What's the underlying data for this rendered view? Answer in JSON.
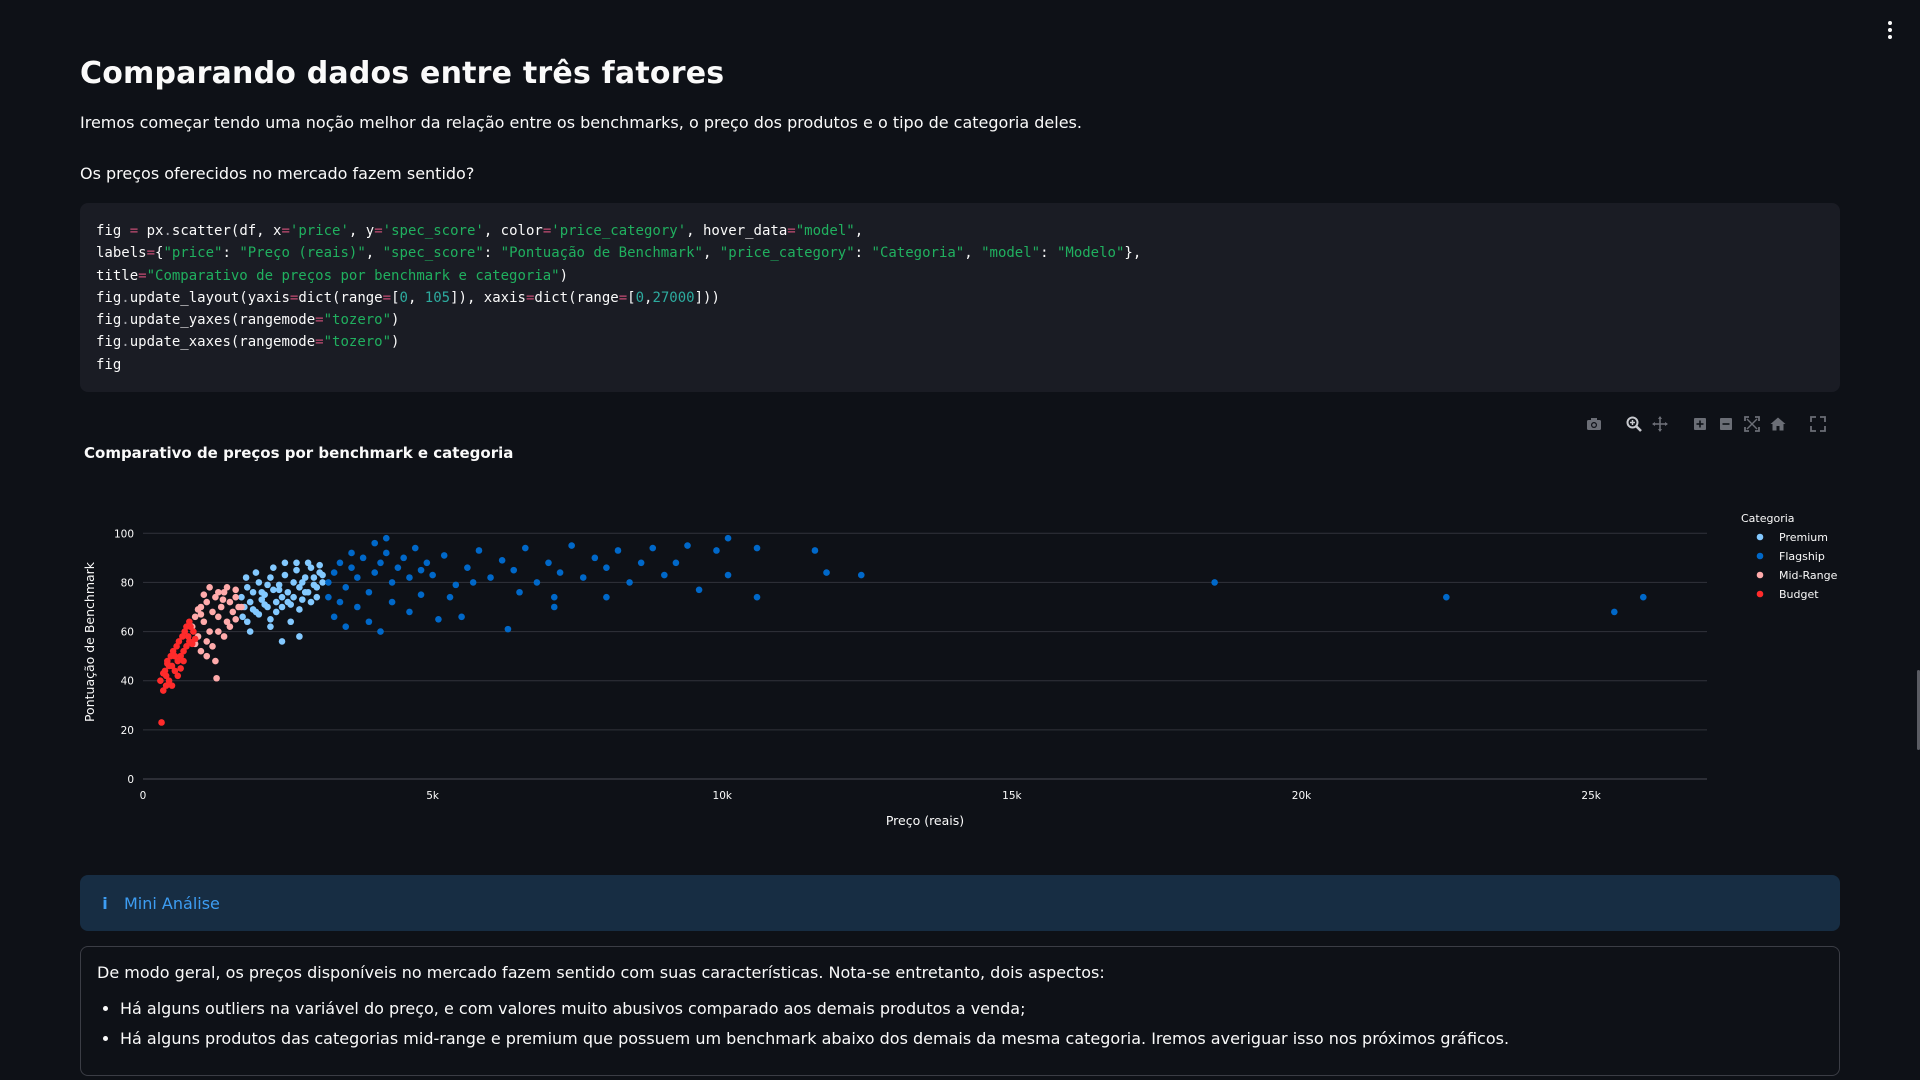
{
  "page": {
    "title": "Comparando dados entre três fatores",
    "intro": "Iremos começar tendo uma noção melhor da relação entre os benchmarks, o preço dos produtos e o tipo de categoria deles.",
    "question": "Os preços oferecidos no mercado fazem sentido?"
  },
  "code": {
    "lines": [
      [
        {
          "t": "fig "
        },
        {
          "t": "=",
          "c": "op"
        },
        {
          "t": " px"
        },
        {
          "t": ".",
          "c": "dim"
        },
        {
          "t": "scatter(df, x"
        },
        {
          "t": "=",
          "c": "op"
        },
        {
          "t": "'price'",
          "c": "str"
        },
        {
          "t": ", y"
        },
        {
          "t": "=",
          "c": "op"
        },
        {
          "t": "'spec_score'",
          "c": "str"
        },
        {
          "t": ", color"
        },
        {
          "t": "=",
          "c": "op"
        },
        {
          "t": "'price_category'",
          "c": "str"
        },
        {
          "t": ", hover_data"
        },
        {
          "t": "=",
          "c": "op"
        },
        {
          "t": "\"model\"",
          "c": "str"
        },
        {
          "t": ","
        }
      ],
      [
        {
          "t": "labels"
        },
        {
          "t": "=",
          "c": "op"
        },
        {
          "t": "{"
        },
        {
          "t": "\"price\"",
          "c": "str"
        },
        {
          "t": ": "
        },
        {
          "t": "\"Preço (reais)\"",
          "c": "str"
        },
        {
          "t": ", "
        },
        {
          "t": "\"spec_score\"",
          "c": "str"
        },
        {
          "t": ": "
        },
        {
          "t": "\"Pontuação de Benchmark\"",
          "c": "str"
        },
        {
          "t": ", "
        },
        {
          "t": "\"price_category\"",
          "c": "str"
        },
        {
          "t": ": "
        },
        {
          "t": "\"Categoria\"",
          "c": "str"
        },
        {
          "t": ", "
        },
        {
          "t": "\"model\"",
          "c": "str"
        },
        {
          "t": ": "
        },
        {
          "t": "\"Modelo\"",
          "c": "str"
        },
        {
          "t": "},"
        }
      ],
      [
        {
          "t": "title"
        },
        {
          "t": "=",
          "c": "op"
        },
        {
          "t": "\"Comparativo de preços por benchmark e categoria\"",
          "c": "str"
        },
        {
          "t": ")"
        }
      ],
      [
        {
          "t": "fig"
        },
        {
          "t": ".",
          "c": "dim"
        },
        {
          "t": "update_layout(yaxis"
        },
        {
          "t": "=",
          "c": "op"
        },
        {
          "t": "dict(range"
        },
        {
          "t": "=",
          "c": "op"
        },
        {
          "t": "["
        },
        {
          "t": "0",
          "c": "num"
        },
        {
          "t": ", "
        },
        {
          "t": "105",
          "c": "num"
        },
        {
          "t": "]), xaxis"
        },
        {
          "t": "=",
          "c": "op"
        },
        {
          "t": "dict(range"
        },
        {
          "t": "=",
          "c": "op"
        },
        {
          "t": "["
        },
        {
          "t": "0",
          "c": "num"
        },
        {
          "t": ","
        },
        {
          "t": "27000",
          "c": "num"
        },
        {
          "t": "]))"
        }
      ],
      [
        {
          "t": "fig"
        },
        {
          "t": ".",
          "c": "dim"
        },
        {
          "t": "update_yaxes(rangemode"
        },
        {
          "t": "=",
          "c": "op"
        },
        {
          "t": "\"tozero\"",
          "c": "str"
        },
        {
          "t": ")"
        }
      ],
      [
        {
          "t": "fig"
        },
        {
          "t": ".",
          "c": "dim"
        },
        {
          "t": "update_xaxes(rangemode"
        },
        {
          "t": "=",
          "c": "op"
        },
        {
          "t": "\"tozero\"",
          "c": "str"
        },
        {
          "t": ")"
        }
      ],
      [
        {
          "t": "fig"
        }
      ]
    ]
  },
  "chart_data": {
    "type": "scatter",
    "title": "Comparativo de preços por benchmark e categoria",
    "xlabel": "Preço (reais)",
    "ylabel": "Pontuação de Benchmark",
    "xlim": [
      0,
      27000
    ],
    "ylim": [
      0,
      105
    ],
    "xticks": [
      0,
      5000,
      10000,
      15000,
      20000,
      25000
    ],
    "xtick_labels": [
      "0",
      "5k",
      "10k",
      "15k",
      "20k",
      "25k"
    ],
    "yticks": [
      0,
      20,
      40,
      60,
      80,
      100
    ],
    "grid": true,
    "legend_title": "Categoria",
    "legend_position": "right",
    "series": [
      {
        "name": "Premium",
        "color": "#83c9ff",
        "points": [
          [
            1700,
            74
          ],
          [
            1750,
            70
          ],
          [
            1800,
            78
          ],
          [
            1850,
            72
          ],
          [
            1900,
            76
          ],
          [
            1950,
            68
          ],
          [
            2000,
            80
          ],
          [
            2050,
            73
          ],
          [
            2100,
            75
          ],
          [
            2150,
            70
          ],
          [
            2200,
            82
          ],
          [
            2250,
            77
          ],
          [
            2300,
            72
          ],
          [
            2350,
            79
          ],
          [
            2400,
            74
          ],
          [
            2450,
            83
          ],
          [
            2500,
            76
          ],
          [
            2550,
            71
          ],
          [
            2600,
            80
          ],
          [
            2650,
            85
          ],
          [
            2700,
            78
          ],
          [
            2750,
            73
          ],
          [
            2800,
            82
          ],
          [
            2850,
            76
          ],
          [
            2900,
            86
          ],
          [
            2950,
            79
          ],
          [
            3000,
            74
          ],
          [
            3050,
            84
          ],
          [
            3100,
            80
          ],
          [
            1720,
            66
          ],
          [
            1800,
            64
          ],
          [
            1900,
            69
          ],
          [
            2000,
            67
          ],
          [
            2100,
            71
          ],
          [
            2200,
            65
          ],
          [
            2300,
            68
          ],
          [
            2400,
            70
          ],
          [
            2500,
            72
          ],
          [
            2600,
            74
          ],
          [
            2700,
            69
          ],
          [
            2800,
            76
          ],
          [
            2900,
            72
          ],
          [
            3000,
            78
          ],
          [
            3100,
            83
          ],
          [
            1780,
            82
          ],
          [
            1950,
            84
          ],
          [
            2250,
            86
          ],
          [
            2450,
            88
          ],
          [
            2650,
            88
          ],
          [
            2850,
            88
          ],
          [
            3050,
            87
          ],
          [
            1850,
            60
          ],
          [
            2400,
            56
          ],
          [
            2700,
            58
          ],
          [
            2200,
            62
          ],
          [
            2550,
            64
          ],
          [
            2350,
            77
          ],
          [
            2150,
            79
          ],
          [
            2050,
            76
          ],
          [
            2750,
            80
          ],
          [
            2950,
            82
          ]
        ]
      },
      {
        "name": "Flagship",
        "color": "#0068c9",
        "points": [
          [
            3200,
            80
          ],
          [
            3300,
            84
          ],
          [
            3400,
            88
          ],
          [
            3500,
            78
          ],
          [
            3600,
            86
          ],
          [
            3700,
            82
          ],
          [
            3800,
            90
          ],
          [
            3900,
            76
          ],
          [
            4000,
            84
          ],
          [
            4100,
            88
          ],
          [
            4200,
            92
          ],
          [
            4300,
            80
          ],
          [
            4400,
            86
          ],
          [
            4500,
            90
          ],
          [
            4600,
            82
          ],
          [
            4700,
            94
          ],
          [
            4800,
            85
          ],
          [
            4900,
            88
          ],
          [
            5000,
            83
          ],
          [
            5200,
            91
          ],
          [
            5400,
            79
          ],
          [
            5600,
            86
          ],
          [
            5800,
            93
          ],
          [
            6000,
            82
          ],
          [
            6200,
            89
          ],
          [
            6400,
            85
          ],
          [
            6600,
            94
          ],
          [
            6800,
            80
          ],
          [
            7000,
            88
          ],
          [
            7200,
            84
          ],
          [
            7400,
            95
          ],
          [
            7600,
            82
          ],
          [
            7800,
            90
          ],
          [
            8000,
            86
          ],
          [
            8200,
            93
          ],
          [
            8400,
            80
          ],
          [
            8600,
            88
          ],
          [
            8800,
            94
          ],
          [
            9000,
            83
          ],
          [
            9200,
            88
          ],
          [
            9400,
            95
          ],
          [
            9600,
            77
          ],
          [
            10100,
            98
          ],
          [
            10100,
            83
          ],
          [
            10600,
            94
          ],
          [
            10600,
            74
          ],
          [
            11600,
            93
          ],
          [
            11800,
            84
          ],
          [
            12400,
            83
          ],
          [
            3300,
            66
          ],
          [
            3500,
            62
          ],
          [
            3700,
            70
          ],
          [
            3900,
            64
          ],
          [
            4100,
            60
          ],
          [
            4300,
            72
          ],
          [
            4600,
            68
          ],
          [
            4800,
            75
          ],
          [
            5100,
            65
          ],
          [
            5300,
            74
          ],
          [
            5500,
            66
          ],
          [
            6300,
            61
          ],
          [
            7100,
            74
          ],
          [
            7100,
            70
          ],
          [
            8000,
            74
          ],
          [
            4200,
            98
          ],
          [
            4000,
            96
          ],
          [
            3600,
            92
          ],
          [
            6500,
            76
          ],
          [
            5700,
            80
          ],
          [
            9900,
            93
          ],
          [
            3200,
            74
          ],
          [
            3400,
            72
          ],
          [
            18500,
            80
          ],
          [
            22500,
            74
          ],
          [
            25400,
            68
          ],
          [
            25900,
            74
          ]
        ]
      },
      {
        "name": "Mid-Range",
        "color": "#ffabab",
        "points": [
          [
            850,
            62
          ],
          [
            900,
            66
          ],
          [
            950,
            58
          ],
          [
            1000,
            70
          ],
          [
            1050,
            64
          ],
          [
            1100,
            72
          ],
          [
            1150,
            60
          ],
          [
            1200,
            68
          ],
          [
            1250,
            74
          ],
          [
            1300,
            66
          ],
          [
            1350,
            70
          ],
          [
            1400,
            76
          ],
          [
            1450,
            64
          ],
          [
            1500,
            72
          ],
          [
            1550,
            68
          ],
          [
            1600,
            74
          ],
          [
            1650,
            70
          ],
          [
            900,
            55
          ],
          [
            1000,
            52
          ],
          [
            1100,
            56
          ],
          [
            1200,
            54
          ],
          [
            1300,
            60
          ],
          [
            1400,
            58
          ],
          [
            1500,
            62
          ],
          [
            1600,
            65
          ],
          [
            1150,
            78
          ],
          [
            1300,
            76
          ],
          [
            1450,
            78
          ],
          [
            1250,
            48
          ],
          [
            1100,
            50
          ],
          [
            1600,
            77
          ],
          [
            1000,
            67
          ],
          [
            1050,
            75
          ],
          [
            1380,
            73
          ],
          [
            1270,
            41
          ],
          [
            950,
            69
          ],
          [
            1700,
            70
          ]
        ]
      },
      {
        "name": "Budget",
        "color": "#ff2b2b",
        "points": [
          [
            300,
            40
          ],
          [
            320,
            23
          ],
          [
            350,
            36
          ],
          [
            380,
            44
          ],
          [
            400,
            42
          ],
          [
            420,
            48
          ],
          [
            450,
            40
          ],
          [
            480,
            50
          ],
          [
            500,
            46
          ],
          [
            520,
            52
          ],
          [
            550,
            44
          ],
          [
            580,
            54
          ],
          [
            600,
            48
          ],
          [
            620,
            56
          ],
          [
            650,
            50
          ],
          [
            680,
            58
          ],
          [
            700,
            52
          ],
          [
            720,
            60
          ],
          [
            750,
            54
          ],
          [
            780,
            58
          ],
          [
            800,
            56
          ],
          [
            820,
            62
          ],
          [
            850,
            55
          ],
          [
            870,
            60
          ],
          [
            900,
            57
          ],
          [
            500,
            38
          ],
          [
            450,
            46
          ],
          [
            600,
            42
          ],
          [
            700,
            48
          ],
          [
            750,
            62
          ],
          [
            800,
            64
          ],
          [
            650,
            45
          ],
          [
            550,
            50
          ],
          [
            350,
            43
          ],
          [
            400,
            38
          ],
          [
            420,
            47
          ]
        ]
      }
    ]
  },
  "chart_ui": {
    "modebar": [
      "camera-icon",
      "zoom-icon",
      "pan-icon",
      "zoom-in-icon",
      "zoom-out-icon",
      "autoscale-icon",
      "reset-axes-icon",
      "fullscreen-icon"
    ]
  },
  "info": {
    "label": "Mini Análise",
    "icon": "i"
  },
  "analysis": {
    "intro": "De modo geral, os preços disponíveis no mercado fazem sentido com suas características. Nota-se entretanto, dois aspectos:",
    "bullets": [
      "Há alguns outliers na variável do preço, e com valores muito abusivos comparado aos demais produtos a venda;",
      "Há alguns produtos das categorias mid-range e premium que possuem um benchmark abaixo dos demais da mesma categoria. Iremos averiguar isso nos próximos gráficos."
    ]
  }
}
